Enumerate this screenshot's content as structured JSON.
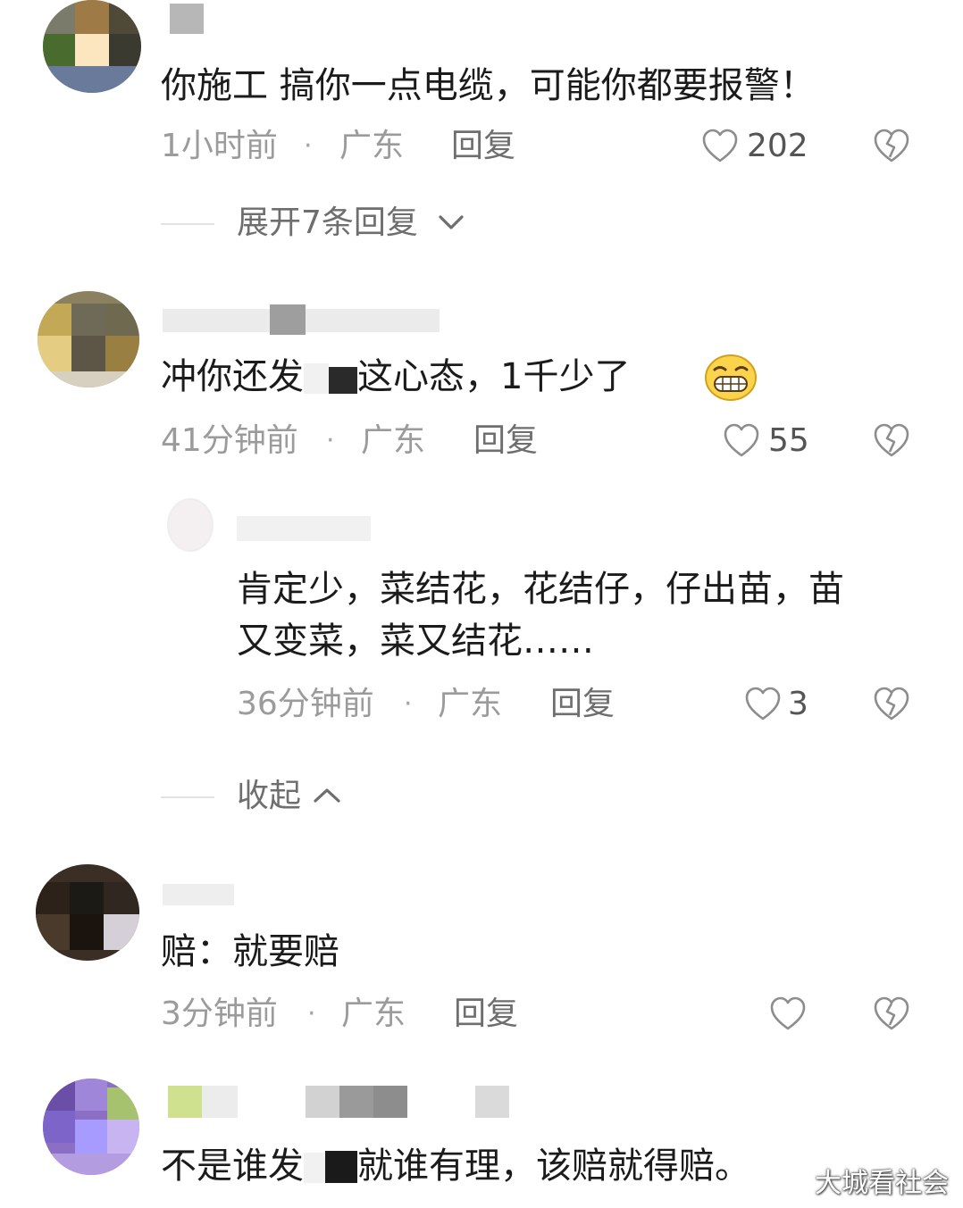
{
  "comments": [
    {
      "text": "你施工  搞你一点电缆，可能你都要报警！",
      "time": "1小时前",
      "dot": "·",
      "location": "广东",
      "reply": "回复",
      "likes": "202",
      "expand": "展开7条回复"
    },
    {
      "text_before": "冲你还发",
      "text_after": "这心态，1千少了",
      "time": "41分钟前",
      "dot": "·",
      "location": "广东",
      "reply": "回复",
      "likes": "55",
      "reply_item": {
        "text_line1": "肯定少，菜结花，花结仔，仔出苗，苗",
        "text_line2": "又变菜，菜又结花……",
        "time": "36分钟前",
        "dot": "·",
        "location": "广东",
        "reply": "回复",
        "likes": "3"
      },
      "collapse": "收起"
    },
    {
      "text": "赔：就要赔",
      "time": "3分钟前",
      "dot": "·",
      "location": "广东",
      "reply": "回复",
      "likes": ""
    },
    {
      "text_before": "不是谁发",
      "text_after": "就谁有理，该赔就得赔",
      "end_mark": "。"
    }
  ],
  "watermark": "大城看社会",
  "icons": {
    "like": "heart-outline-icon",
    "dislike": "broken-heart-icon",
    "chevron_down": "chevron-down-icon",
    "chevron_up": "chevron-up-icon",
    "emoji": "grinning-face-emoji-icon"
  }
}
